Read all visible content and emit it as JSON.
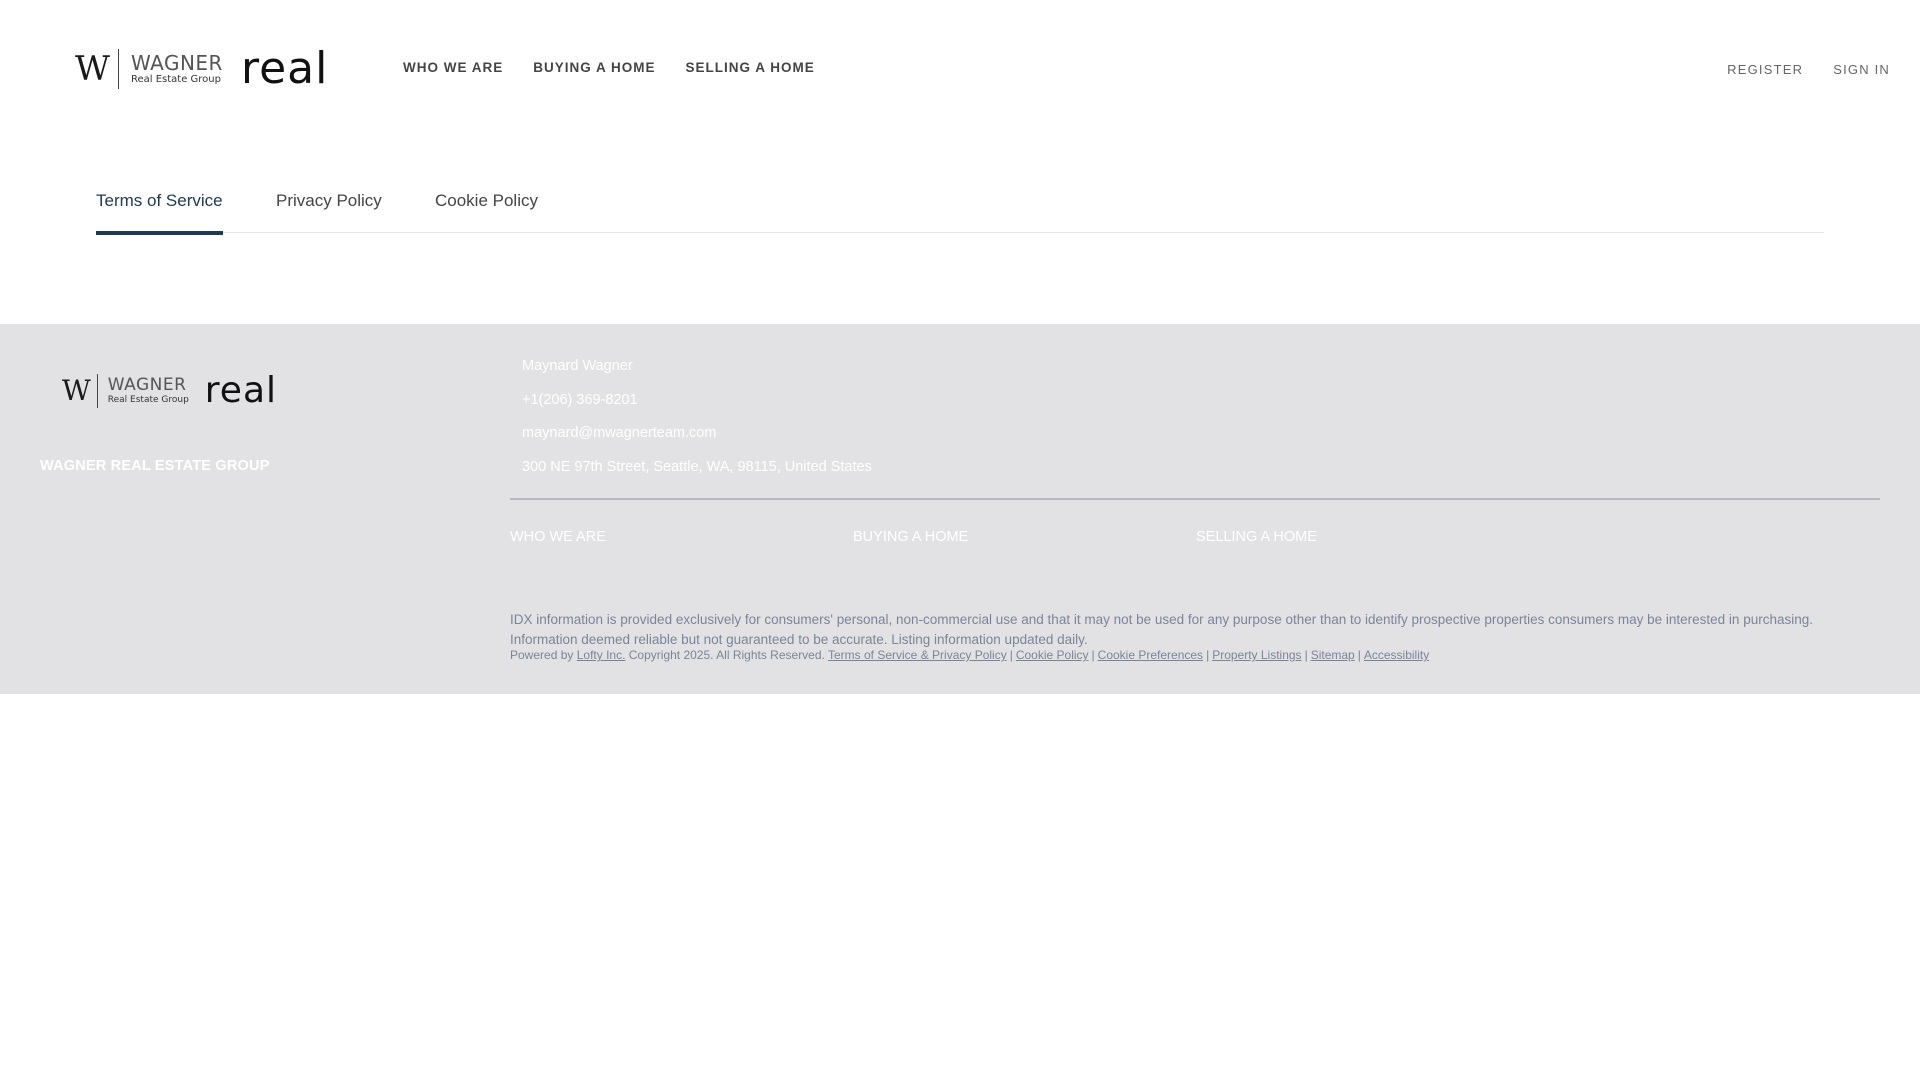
{
  "brand": {
    "mark": "W",
    "name": "WAGNER",
    "sub": "Real Estate Group",
    "partner": "real"
  },
  "header": {
    "nav": [
      "WHO WE ARE",
      "BUYING A HOME",
      "SELLING A HOME"
    ],
    "account": {
      "register": "REGISTER",
      "sign_in": "SIGN IN"
    }
  },
  "policy_tabs": {
    "items": [
      "Terms of Service",
      "Privacy Policy",
      "Cookie Policy"
    ],
    "active": "Terms of Service"
  },
  "footer": {
    "company": "WAGNER REAL ESTATE GROUP",
    "contact": {
      "name": "Maynard Wagner",
      "phone": "+1(206) 369-8201",
      "email": "maynard@mwagnerteam.com",
      "address": "300 NE 97th Street, Seattle, WA, 98115, United States"
    },
    "nav": [
      "WHO WE ARE",
      "BUYING A HOME",
      "SELLING A HOME"
    ],
    "disclaimer": "IDX information is provided exclusively for consumers' personal, non-commercial use and that it may not be used for any purpose other than to identify prospective properties consumers may be interested in purchasing. Information deemed reliable but not guaranteed to be accurate. Listing information updated daily.",
    "legal": {
      "powered_by": "Powered by",
      "company_link": "Lofty Inc.",
      "copyright": "Copyright 2025. All Rights Reserved.",
      "links": [
        "Terms of Service & Privacy Policy",
        "Cookie Policy",
        "Cookie Preferences",
        "Property Listings",
        "Sitemap",
        "Accessibility"
      ],
      "separator": "|"
    }
  },
  "colors": {
    "accent": "#1e3a52",
    "footer_bg": "#e2e2e4",
    "footer_text": "#ffffff",
    "muted_text": "#7b8497"
  }
}
